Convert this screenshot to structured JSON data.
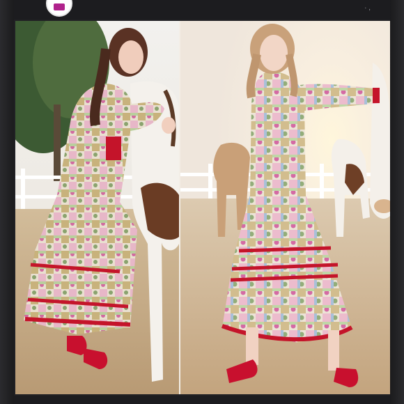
{
  "app": {
    "status_text": "·  ,"
  },
  "images": {
    "left_photo": {
      "name": "model-with-horse-left"
    },
    "right_photo": {
      "name": "model-standing-right"
    }
  },
  "colors": {
    "accent": "#b0228c",
    "dress_trim": "#c4142a",
    "shoes": "#c8102e",
    "sky": "#f7f2ea",
    "ground": "#c7ab86"
  }
}
